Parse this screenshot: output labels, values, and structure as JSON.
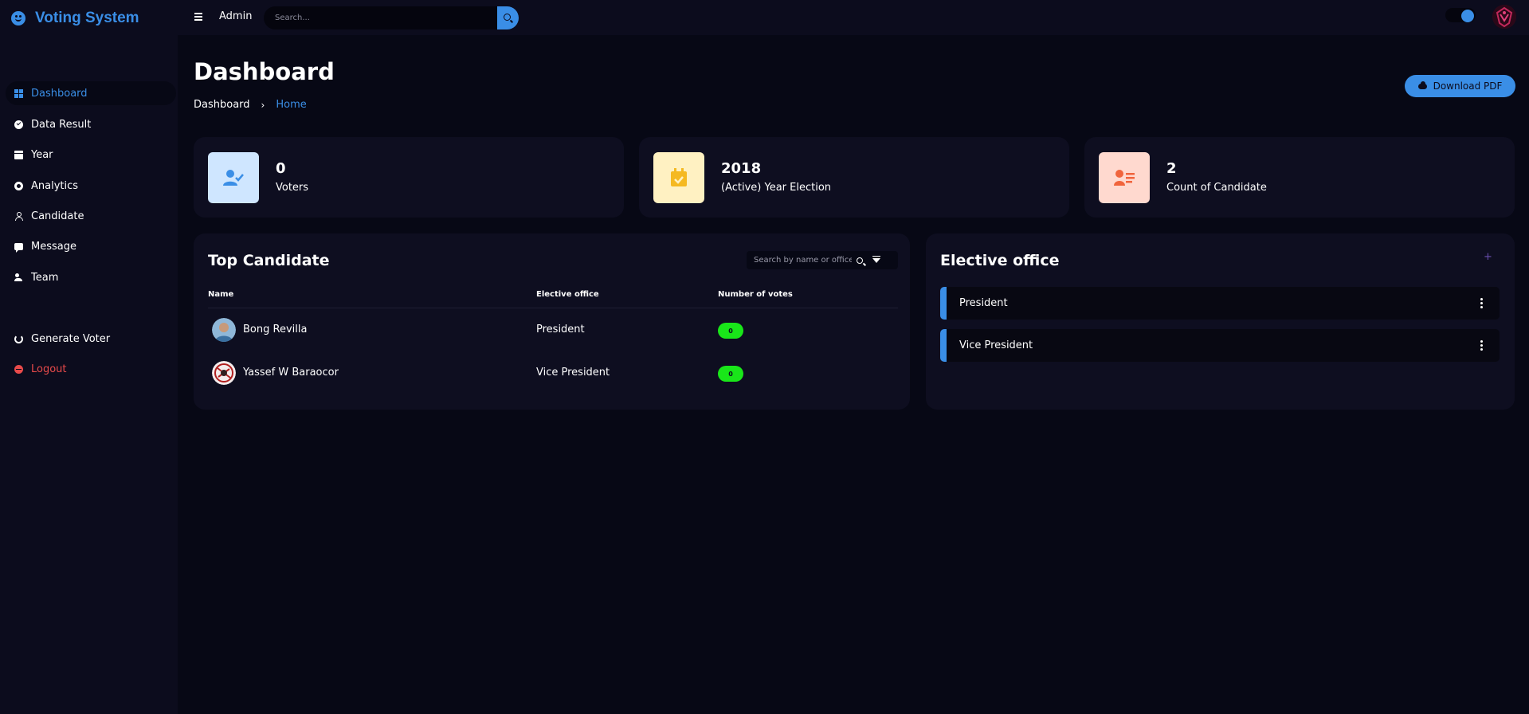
{
  "app": {
    "title": "Voting System"
  },
  "topbar": {
    "user_label": "Admin",
    "search_placeholder": "Search..."
  },
  "sidebar": {
    "items": [
      {
        "label": "Dashboard",
        "icon": "dashboard-icon",
        "active": true
      },
      {
        "label": "Data Result",
        "icon": "check-circle-icon"
      },
      {
        "label": "Year",
        "icon": "calendar-icon"
      },
      {
        "label": "Analytics",
        "icon": "ring-chart-icon"
      },
      {
        "label": "Candidate",
        "icon": "user-icon"
      },
      {
        "label": "Message",
        "icon": "message-icon"
      },
      {
        "label": "Team",
        "icon": "team-icon"
      },
      {
        "label": "Generate Voter",
        "icon": "sync-icon"
      },
      {
        "label": "Logout",
        "icon": "logout-icon"
      }
    ]
  },
  "page": {
    "title": "Dashboard",
    "breadcrumb": [
      "Dashboard",
      "Home"
    ],
    "download_label": "Download PDF"
  },
  "stats": [
    {
      "value": "0",
      "label": "Voters",
      "icon": "user-check-icon",
      "icon_bg": "#cfe6ff",
      "icon_color": "#3a8ee6"
    },
    {
      "value": "2018",
      "label": "(Active) Year Election",
      "icon": "calendar-check-icon",
      "icon_bg": "#fff1c2",
      "icon_color": "#f5b921"
    },
    {
      "value": "2",
      "label": "Count of Candidate",
      "icon": "id-card-icon",
      "icon_bg": "#ffd9cf",
      "icon_color": "#f0643c"
    }
  ],
  "top_candidate": {
    "title": "Top Candidate",
    "search_placeholder": "Search by name or office",
    "columns": [
      "Name",
      "Elective office",
      "Number of votes"
    ],
    "rows": [
      {
        "name": "Bong Revilla",
        "office": "President",
        "votes": "0"
      },
      {
        "name": "Yassef W Baraocor",
        "office": "Vice President",
        "votes": "0"
      }
    ]
  },
  "elective_office": {
    "title": "Elective office",
    "add_label": "+",
    "items": [
      "President",
      "Vice President"
    ]
  },
  "colors": {
    "accent": "#3a8ee6",
    "background": "#070815",
    "panel": "#0e0e20",
    "vote_badge": "#19e619",
    "logout": "#e84a4a"
  }
}
